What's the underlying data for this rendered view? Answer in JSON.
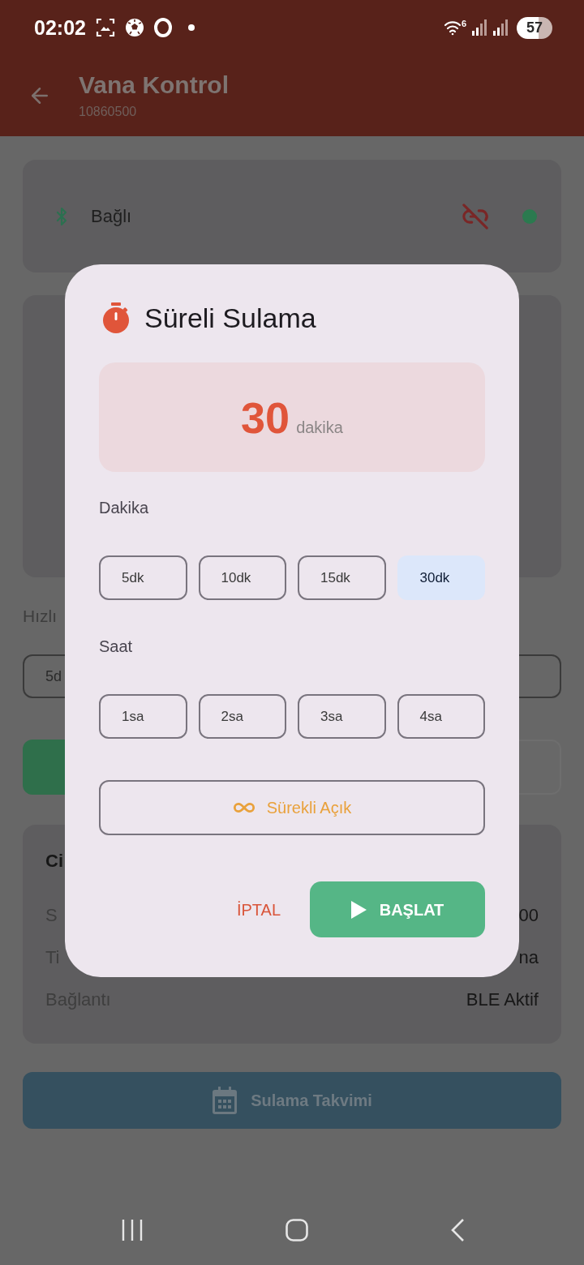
{
  "status_bar": {
    "time": "02:02",
    "wifi_label": "6",
    "battery": "57"
  },
  "app_bar": {
    "title": "Vana Kontrol",
    "subtitle": "10860500"
  },
  "connection_card": {
    "status": "Bağlı"
  },
  "quick_section": {
    "label": "Hızlı",
    "field_value": "5d"
  },
  "info_card": {
    "title": "Ci",
    "rows": [
      {
        "label": "S",
        "value": "00"
      },
      {
        "label": "Ti",
        "value": "na"
      },
      {
        "label": "Bağlantı",
        "value": "BLE Aktif"
      }
    ]
  },
  "schedule_button": {
    "label": "Sulama Takvimi"
  },
  "dialog": {
    "title": "Süreli Sulama",
    "amount": {
      "value": "30",
      "unit": "dakika"
    },
    "sections": [
      {
        "label": "Dakika",
        "options": [
          {
            "label": "5dk",
            "selected": false
          },
          {
            "label": "10dk",
            "selected": false
          },
          {
            "label": "15dk",
            "selected": false
          },
          {
            "label": "30dk",
            "selected": true
          }
        ]
      },
      {
        "label": "Saat",
        "options": [
          {
            "label": "1sa",
            "selected": false
          },
          {
            "label": "2sa",
            "selected": false
          },
          {
            "label": "3sa",
            "selected": false
          },
          {
            "label": "4sa",
            "selected": false
          }
        ]
      }
    ],
    "continuous_button": {
      "label": "Sürekli Açık"
    },
    "cancel_button": {
      "label": "İPTAL"
    },
    "start_button": {
      "label": "BAŞLAT"
    }
  }
}
